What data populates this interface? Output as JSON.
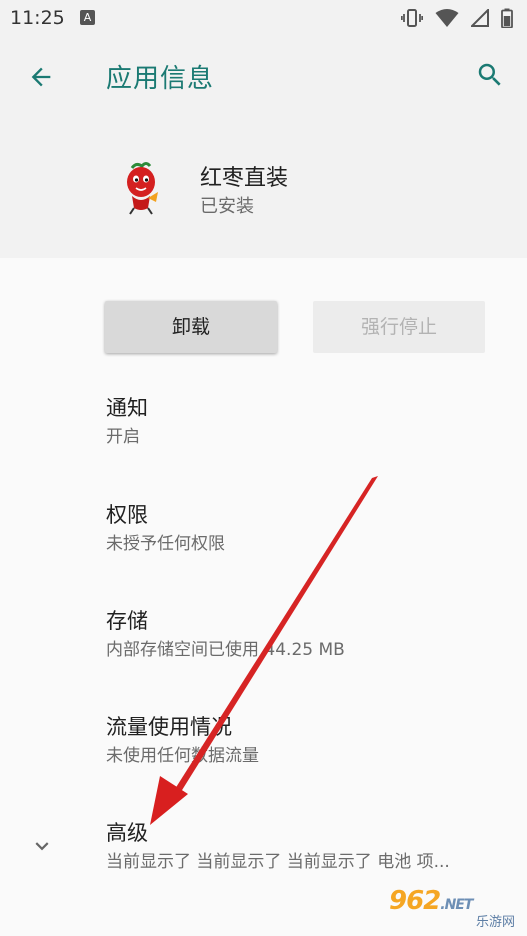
{
  "status_bar": {
    "time": "11:25",
    "notification_letter": "A"
  },
  "app_bar": {
    "title": "应用信息",
    "back_icon": "arrow-back-icon",
    "search_icon": "search-icon",
    "accent_color": "#1b7a73"
  },
  "app": {
    "name": "红枣直装",
    "status": "已安装",
    "icon": "red-date-mascot-icon"
  },
  "buttons": {
    "uninstall": "卸载",
    "force_stop": "强行停止"
  },
  "settings": [
    {
      "title": "通知",
      "subtitle": "开启"
    },
    {
      "title": "权限",
      "subtitle": "未授予任何权限"
    },
    {
      "title": "存储",
      "subtitle": "内部存储空间已使用 44.25 MB"
    },
    {
      "title": "流量使用情况",
      "subtitle": "未使用任何数据流量"
    },
    {
      "title": "高级",
      "subtitle": "当前显示了 当前显示了 当前显示了 电池 项..."
    }
  ],
  "watermark": {
    "brand": "962",
    "suffix": ".NET",
    "name": "乐游网"
  },
  "annotation_arrow_color": "#e02424"
}
